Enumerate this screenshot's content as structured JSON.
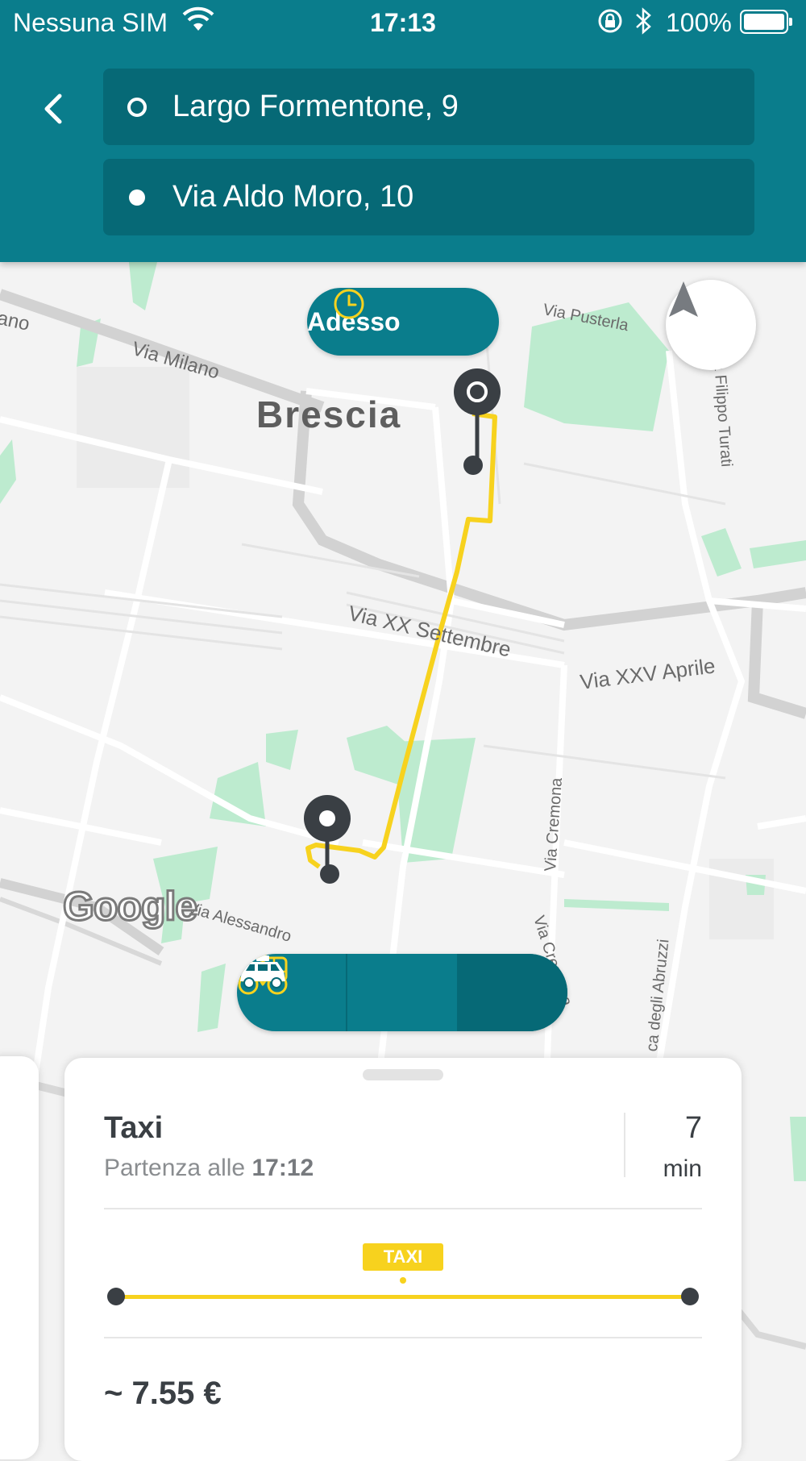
{
  "status_bar": {
    "carrier": "Nessuna SIM",
    "time": "17:13",
    "battery": "100%"
  },
  "search": {
    "origin": "Largo Formentone, 9",
    "destination": "Via Aldo Moro, 10"
  },
  "map": {
    "city": "Brescia",
    "streets": {
      "via_milano": "Via Milano",
      "via_pusterla": "Via Pusterla",
      "via_filippo_turati": "Via Filippo Turati",
      "via_xx_settembre": "Via XX Settembre",
      "via_xxv_aprile": "Via XXV Aprile",
      "via_cremona_1": "Via Cremona",
      "via_cremona_2": "Via Cremona",
      "via_alessandro": "Via Alessandro",
      "via_abruzzi": "ca degli Abruzzi",
      "edge_left": "ano"
    },
    "logo": "Google",
    "time_pill": "Adesso"
  },
  "transport_modes": {
    "items": [
      {
        "icon": "bus-icon",
        "selected": false
      },
      {
        "icon": "bike-sharing-icon",
        "selected": false
      },
      {
        "icon": "taxi-icon",
        "selected": true
      }
    ]
  },
  "route_card": {
    "mode": "Taxi",
    "departure_prefix": "Partenza alle",
    "departure_time": "17:12",
    "duration_value": "7",
    "duration_unit": "min",
    "leg_badge": "TAXI",
    "price": "~ 7.55 €"
  },
  "colors": {
    "header": "#0a7d8c",
    "field": "#066976",
    "route": "#f7d21e",
    "pin": "#3a3f44",
    "park": "#bdebcf"
  }
}
